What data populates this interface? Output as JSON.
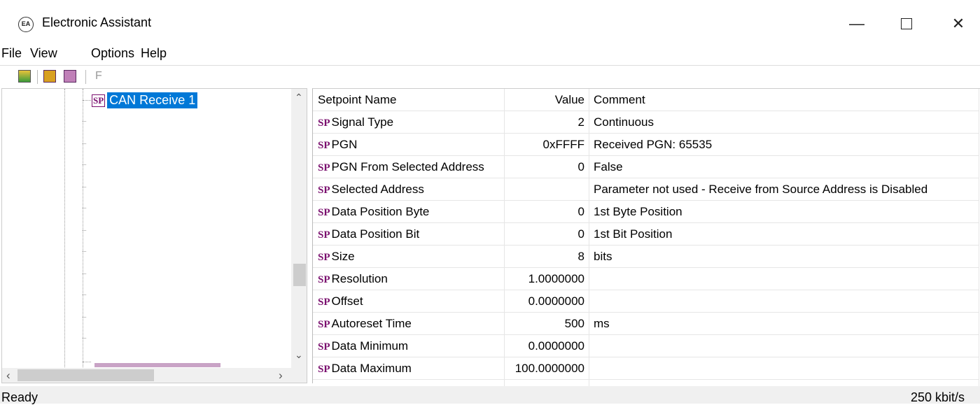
{
  "window": {
    "title": "Electronic Assistant",
    "app_icon_text": "EA",
    "minimize_icon": "minimize-icon",
    "maximize_icon": "maximize-icon",
    "close_icon": "close-icon"
  },
  "menu": [
    "File",
    "View",
    "Options",
    "Help"
  ],
  "toolbar": {
    "icons": [
      "can-icon",
      "save-sp-icon",
      "load-sp-icon",
      "flash-f-icon"
    ],
    "f_label": "F"
  },
  "tree": {
    "selected_badge": "SP",
    "selected_label": "CAN Receive 1"
  },
  "grid": {
    "headers": {
      "name": "Setpoint Name",
      "value": "Value",
      "comment": "Comment"
    },
    "badge": "SP",
    "rows": [
      {
        "name": "Signal Type",
        "value": "2",
        "comment": "Continuous"
      },
      {
        "name": "PGN",
        "value": "0xFFFF",
        "comment": "Received PGN: 65535"
      },
      {
        "name": "PGN From Selected Address",
        "value": "0",
        "comment": "False"
      },
      {
        "name": "Selected Address",
        "value": "",
        "comment": "Parameter not used - Receive from Source Address is Disabled"
      },
      {
        "name": "Data Position Byte",
        "value": "0",
        "comment": "1st Byte Position"
      },
      {
        "name": "Data Position Bit",
        "value": "0",
        "comment": "1st Bit Position"
      },
      {
        "name": "Size",
        "value": "8",
        "comment": "bits"
      },
      {
        "name": "Resolution",
        "value": "1.0000000",
        "comment": ""
      },
      {
        "name": "Offset",
        "value": "0.0000000",
        "comment": ""
      },
      {
        "name": "Autoreset Time",
        "value": "500",
        "comment": "ms"
      },
      {
        "name": "Data Minimum",
        "value": "0.0000000",
        "comment": ""
      },
      {
        "name": "Data Maximum",
        "value": "100.0000000",
        "comment": ""
      }
    ]
  },
  "status": {
    "left": "Ready",
    "right": "250 kbit/s"
  }
}
